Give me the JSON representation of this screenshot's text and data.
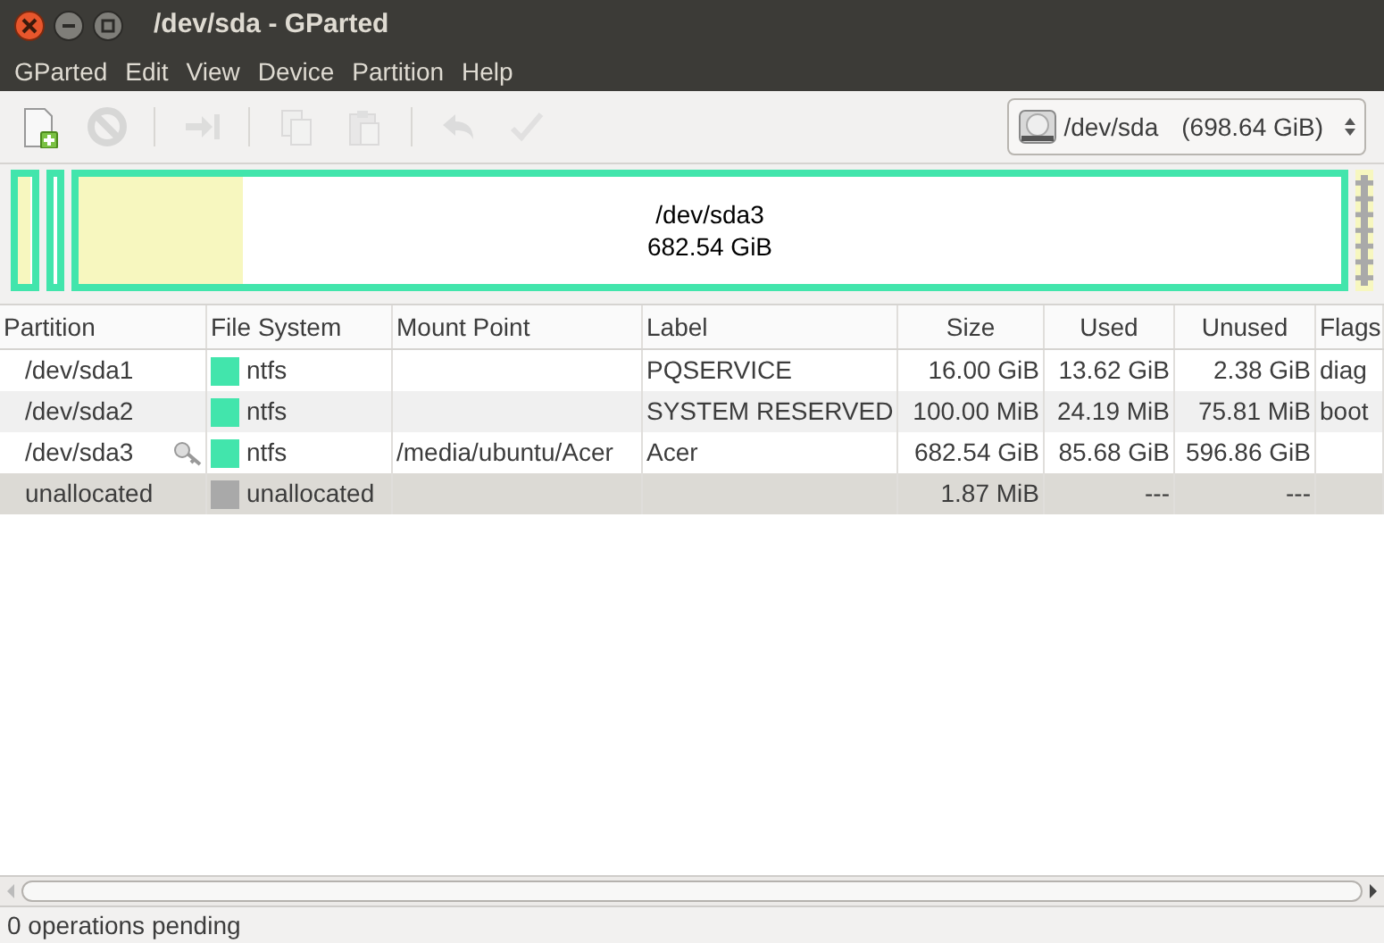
{
  "window": {
    "title": "/dev/sda - GParted"
  },
  "menu": [
    "GParted",
    "Edit",
    "View",
    "Device",
    "Partition",
    "Help"
  ],
  "toolbar": [
    {
      "kind": "new",
      "disabled": false
    },
    {
      "kind": "delete",
      "disabled": true
    },
    {
      "kind": "separator"
    },
    {
      "kind": "resize",
      "disabled": true
    },
    {
      "kind": "separator"
    },
    {
      "kind": "copy",
      "disabled": true
    },
    {
      "kind": "paste",
      "disabled": true
    },
    {
      "kind": "separator"
    },
    {
      "kind": "undo",
      "disabled": true
    },
    {
      "kind": "apply",
      "disabled": true
    }
  ],
  "device_selector": {
    "device": "/dev/sda",
    "size": "(698.64 GiB)"
  },
  "partition_map": [
    {
      "kind": "partition",
      "level": 0.85
    },
    {
      "kind": "partition"
    },
    {
      "kind": "partition",
      "name": "/dev/sda3",
      "size": "682.54 GiB",
      "level": 0.13
    },
    {
      "kind": "unallocated"
    }
  ],
  "table": {
    "columns": [
      "Partition",
      "File System",
      "Mount Point",
      "Label",
      "Size",
      "Used",
      "Unused",
      "Flags"
    ],
    "rows": [
      {
        "partition": "/dev/sda1",
        "mounted": false,
        "fs": "ntfs",
        "color": "#42e5ac",
        "mount": "",
        "label": "PQSERVICE",
        "size": "16.00 GiB",
        "used": "13.62 GiB",
        "unused": "2.38 GiB",
        "flags": "diag",
        "selected": false
      },
      {
        "partition": "/dev/sda2",
        "mounted": false,
        "fs": "ntfs",
        "color": "#42e5ac",
        "mount": "",
        "label": "SYSTEM RESERVED",
        "size": "100.00 MiB",
        "used": "24.19 MiB",
        "unused": "75.81 MiB",
        "flags": "boot",
        "selected": false
      },
      {
        "partition": "/dev/sda3",
        "mounted": true,
        "fs": "ntfs",
        "color": "#42e5ac",
        "mount": "/media/ubuntu/Acer",
        "label": "Acer",
        "size": "682.54 GiB",
        "used": "85.68 GiB",
        "unused": "596.86 GiB",
        "flags": "",
        "selected": false
      },
      {
        "partition": "unallocated",
        "mounted": false,
        "fs": "unallocated",
        "color": "#a9a9a9",
        "mount": "",
        "label": "",
        "size": "1.87 MiB",
        "used": "---",
        "unused": "---",
        "flags": "",
        "selected": true
      }
    ]
  },
  "status_bar": "0 operations pending"
}
